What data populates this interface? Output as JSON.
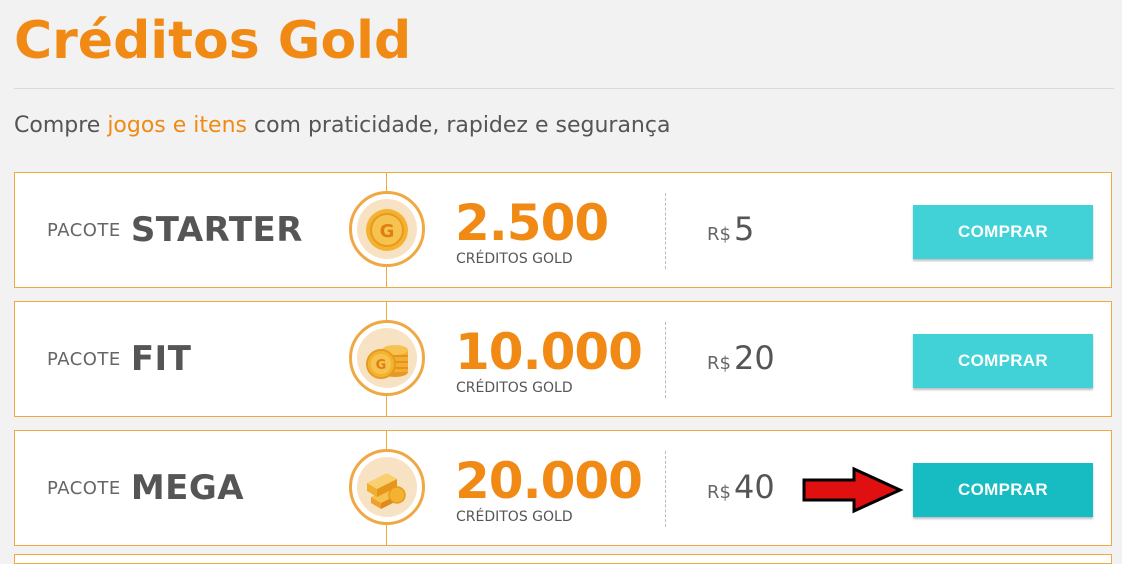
{
  "page": {
    "title": "Créditos Gold",
    "subtitle_before": "Compre ",
    "subtitle_highlight": "jogos e itens",
    "subtitle_after": " com praticidade, rapidez e segurança"
  },
  "colors": {
    "accent": "#f08a14",
    "border": "#f0a845",
    "button": "#40d2d6",
    "button_active": "#17bcc3",
    "arrow": "#e01010"
  },
  "packages": [
    {
      "label": "PACOTE",
      "name": "STARTER",
      "icon": "single-gold-coin-icon",
      "amount": "2.500",
      "amount_label": "CRÉDITOS GOLD",
      "currency": "R$",
      "price": "5",
      "button_label": "COMPRAR"
    },
    {
      "label": "PACOTE",
      "name": "FIT",
      "icon": "coin-stack-icon",
      "amount": "10.000",
      "amount_label": "CRÉDITOS GOLD",
      "currency": "R$",
      "price": "20",
      "button_label": "COMPRAR"
    },
    {
      "label": "PACOTE",
      "name": "MEGA",
      "icon": "gold-bars-icon",
      "amount": "20.000",
      "amount_label": "CRÉDITOS GOLD",
      "currency": "R$",
      "price": "40",
      "button_label": "COMPRAR"
    }
  ],
  "annotation": {
    "icon": "red-arrow-icon"
  }
}
